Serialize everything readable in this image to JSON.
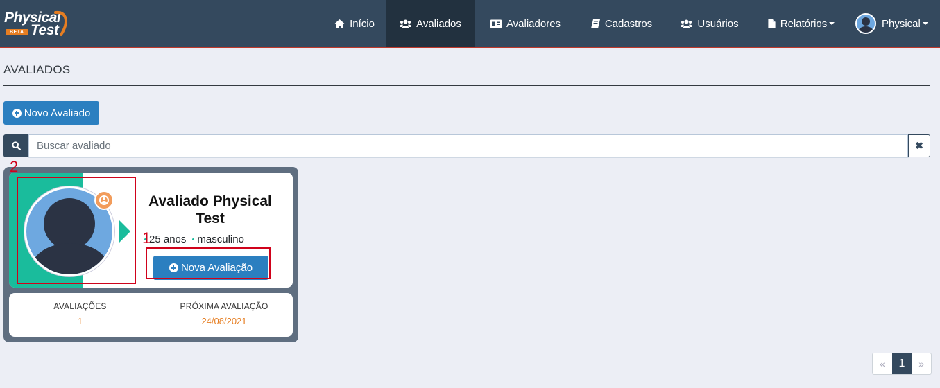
{
  "brand": {
    "line1": "Physical",
    "line2": "Test",
    "beta": "BETA"
  },
  "nav": {
    "items": [
      {
        "label": "Início",
        "icon": "home-icon"
      },
      {
        "label": "Avaliados",
        "icon": "users-icon",
        "active": true
      },
      {
        "label": "Avaliadores",
        "icon": "id-card-icon"
      },
      {
        "label": "Cadastros",
        "icon": "book-icon"
      },
      {
        "label": "Usuários",
        "icon": "users-icon"
      },
      {
        "label": "Relatórios",
        "icon": "file-icon",
        "dropdown": true
      }
    ],
    "user": {
      "name": "Physical"
    }
  },
  "page": {
    "title": "AVALIADOS"
  },
  "actions": {
    "new_label": "Novo Avaliado"
  },
  "search": {
    "placeholder": "Buscar avaliado",
    "value": "",
    "clear_glyph": "✖"
  },
  "card": {
    "name": "Avaliado Physical Test",
    "age": "25 anos",
    "sex": "masculino",
    "new_eval_label": "Nova Avaliação",
    "stats": {
      "evaluations_label": "AVALIAÇÕES",
      "evaluations_value": "1",
      "next_label": "PRÓXIMA AVALIAÇÃO",
      "next_value": "24/08/2021"
    }
  },
  "annotations": {
    "one": "1",
    "two": "2"
  },
  "pagination": {
    "prev": "«",
    "current": "1",
    "next": "»"
  },
  "colors": {
    "navbar": "#34495e",
    "navbar_active": "#22313f",
    "navbar_accent_border": "#c0392b",
    "primary": "#2b7fc0",
    "teal": "#1abc9c",
    "orange": "#e67e22",
    "card_frame": "#5f6e80",
    "annotation_red": "#d0021b",
    "page_bg": "#eceef5"
  }
}
